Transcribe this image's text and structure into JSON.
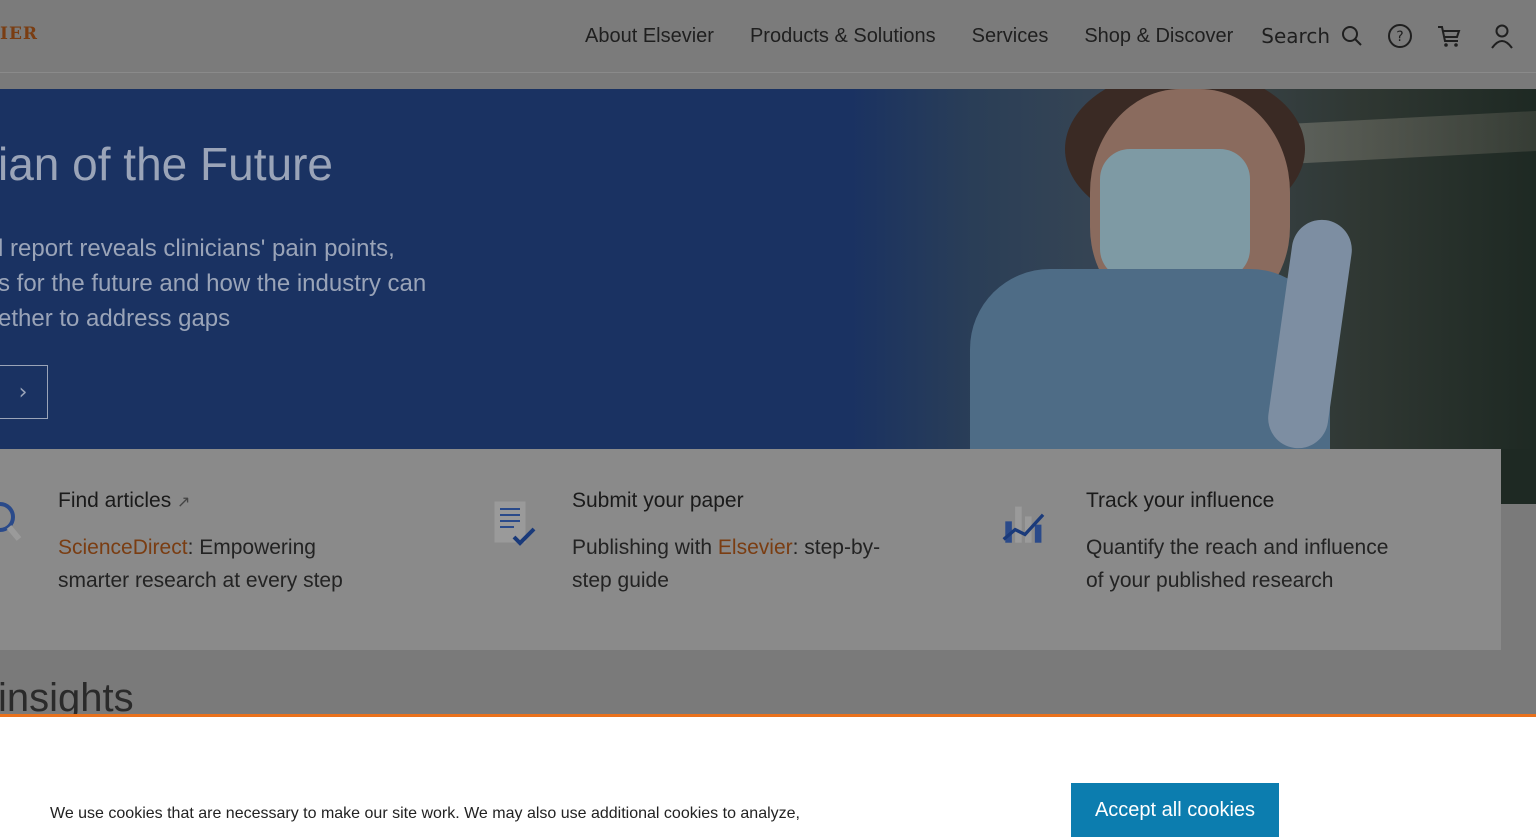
{
  "header": {
    "logo_text": "IER",
    "nav": [
      "About Elsevier",
      "Products & Solutions",
      "Services",
      "Shop & Discover"
    ],
    "search_label": "Search"
  },
  "hero": {
    "title": "ian of the Future",
    "desc_lines": [
      "l report reveals clinicians' pain points,",
      "s for the future and how the industry can",
      "ether to address gaps"
    ],
    "arrow_glyph": "›"
  },
  "cards": [
    {
      "title": "Find articles",
      "title_arrow": "↗",
      "desc_highlight": "ScienceDirect",
      "desc_line1_rest": ": Empowering",
      "desc_line2": "smarter research at every step"
    },
    {
      "title": "Submit your paper",
      "desc_line1_prefix": "Publishing with ",
      "desc_highlight": "Elsevier",
      "desc_line1_rest": ": step-by-",
      "desc_line2": "step guide"
    },
    {
      "title": "Track your influence",
      "desc_line1": "Quantify the reach and influence",
      "desc_line2": "of your published research"
    }
  ],
  "insights_heading": "insights",
  "cookie": {
    "text": "We use cookies that are necessary to make our site work. We may also use additional cookies to analyze,",
    "accept_label": "Accept all cookies"
  },
  "colors": {
    "brand_orange": "#e9711c",
    "hero_blue": "#1a3262",
    "accept_button": "#0c7daf"
  }
}
